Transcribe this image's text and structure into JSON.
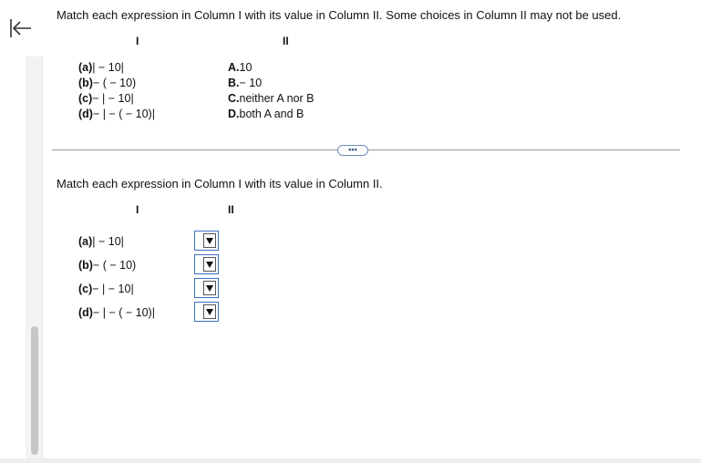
{
  "question1": {
    "instruction": "Match each expression in Column I with its value in Column II. Some choices in Column II may not be used.",
    "col1_header": "I",
    "col2_header": "II",
    "expressions": [
      {
        "label": "(a)",
        "expr": "| − 10|"
      },
      {
        "label": "(b)",
        "expr": "− ( − 10)"
      },
      {
        "label": "(c)",
        "expr": "− | − 10|"
      },
      {
        "label": "(d)",
        "expr": "− | − ( − 10)|"
      }
    ],
    "choices": [
      {
        "label": "A.",
        "value": "10"
      },
      {
        "label": "B.",
        "value": "− 10"
      },
      {
        "label": "C.",
        "value": "neither A nor B"
      },
      {
        "label": "D.",
        "value": "both A and B"
      }
    ]
  },
  "divider": {
    "more_label": "•••"
  },
  "question2": {
    "instruction": "Match each expression in Column I with its value in Column II.",
    "col1_header": "I",
    "col2_header": "II",
    "expressions": [
      {
        "label": "(a)",
        "expr": "| − 10|"
      },
      {
        "label": "(b)",
        "expr": "− ( − 10)"
      },
      {
        "label": "(c)",
        "expr": "− | − 10|"
      },
      {
        "label": "(d)",
        "expr": "− | − ( − 10)|"
      }
    ],
    "dropdowns": [
      {
        "selected": ""
      },
      {
        "selected": ""
      },
      {
        "selected": ""
      },
      {
        "selected": ""
      }
    ]
  },
  "icons": {
    "collapse": "collapse-left-arrow-icon",
    "dropdown": "triangle-down-icon"
  }
}
